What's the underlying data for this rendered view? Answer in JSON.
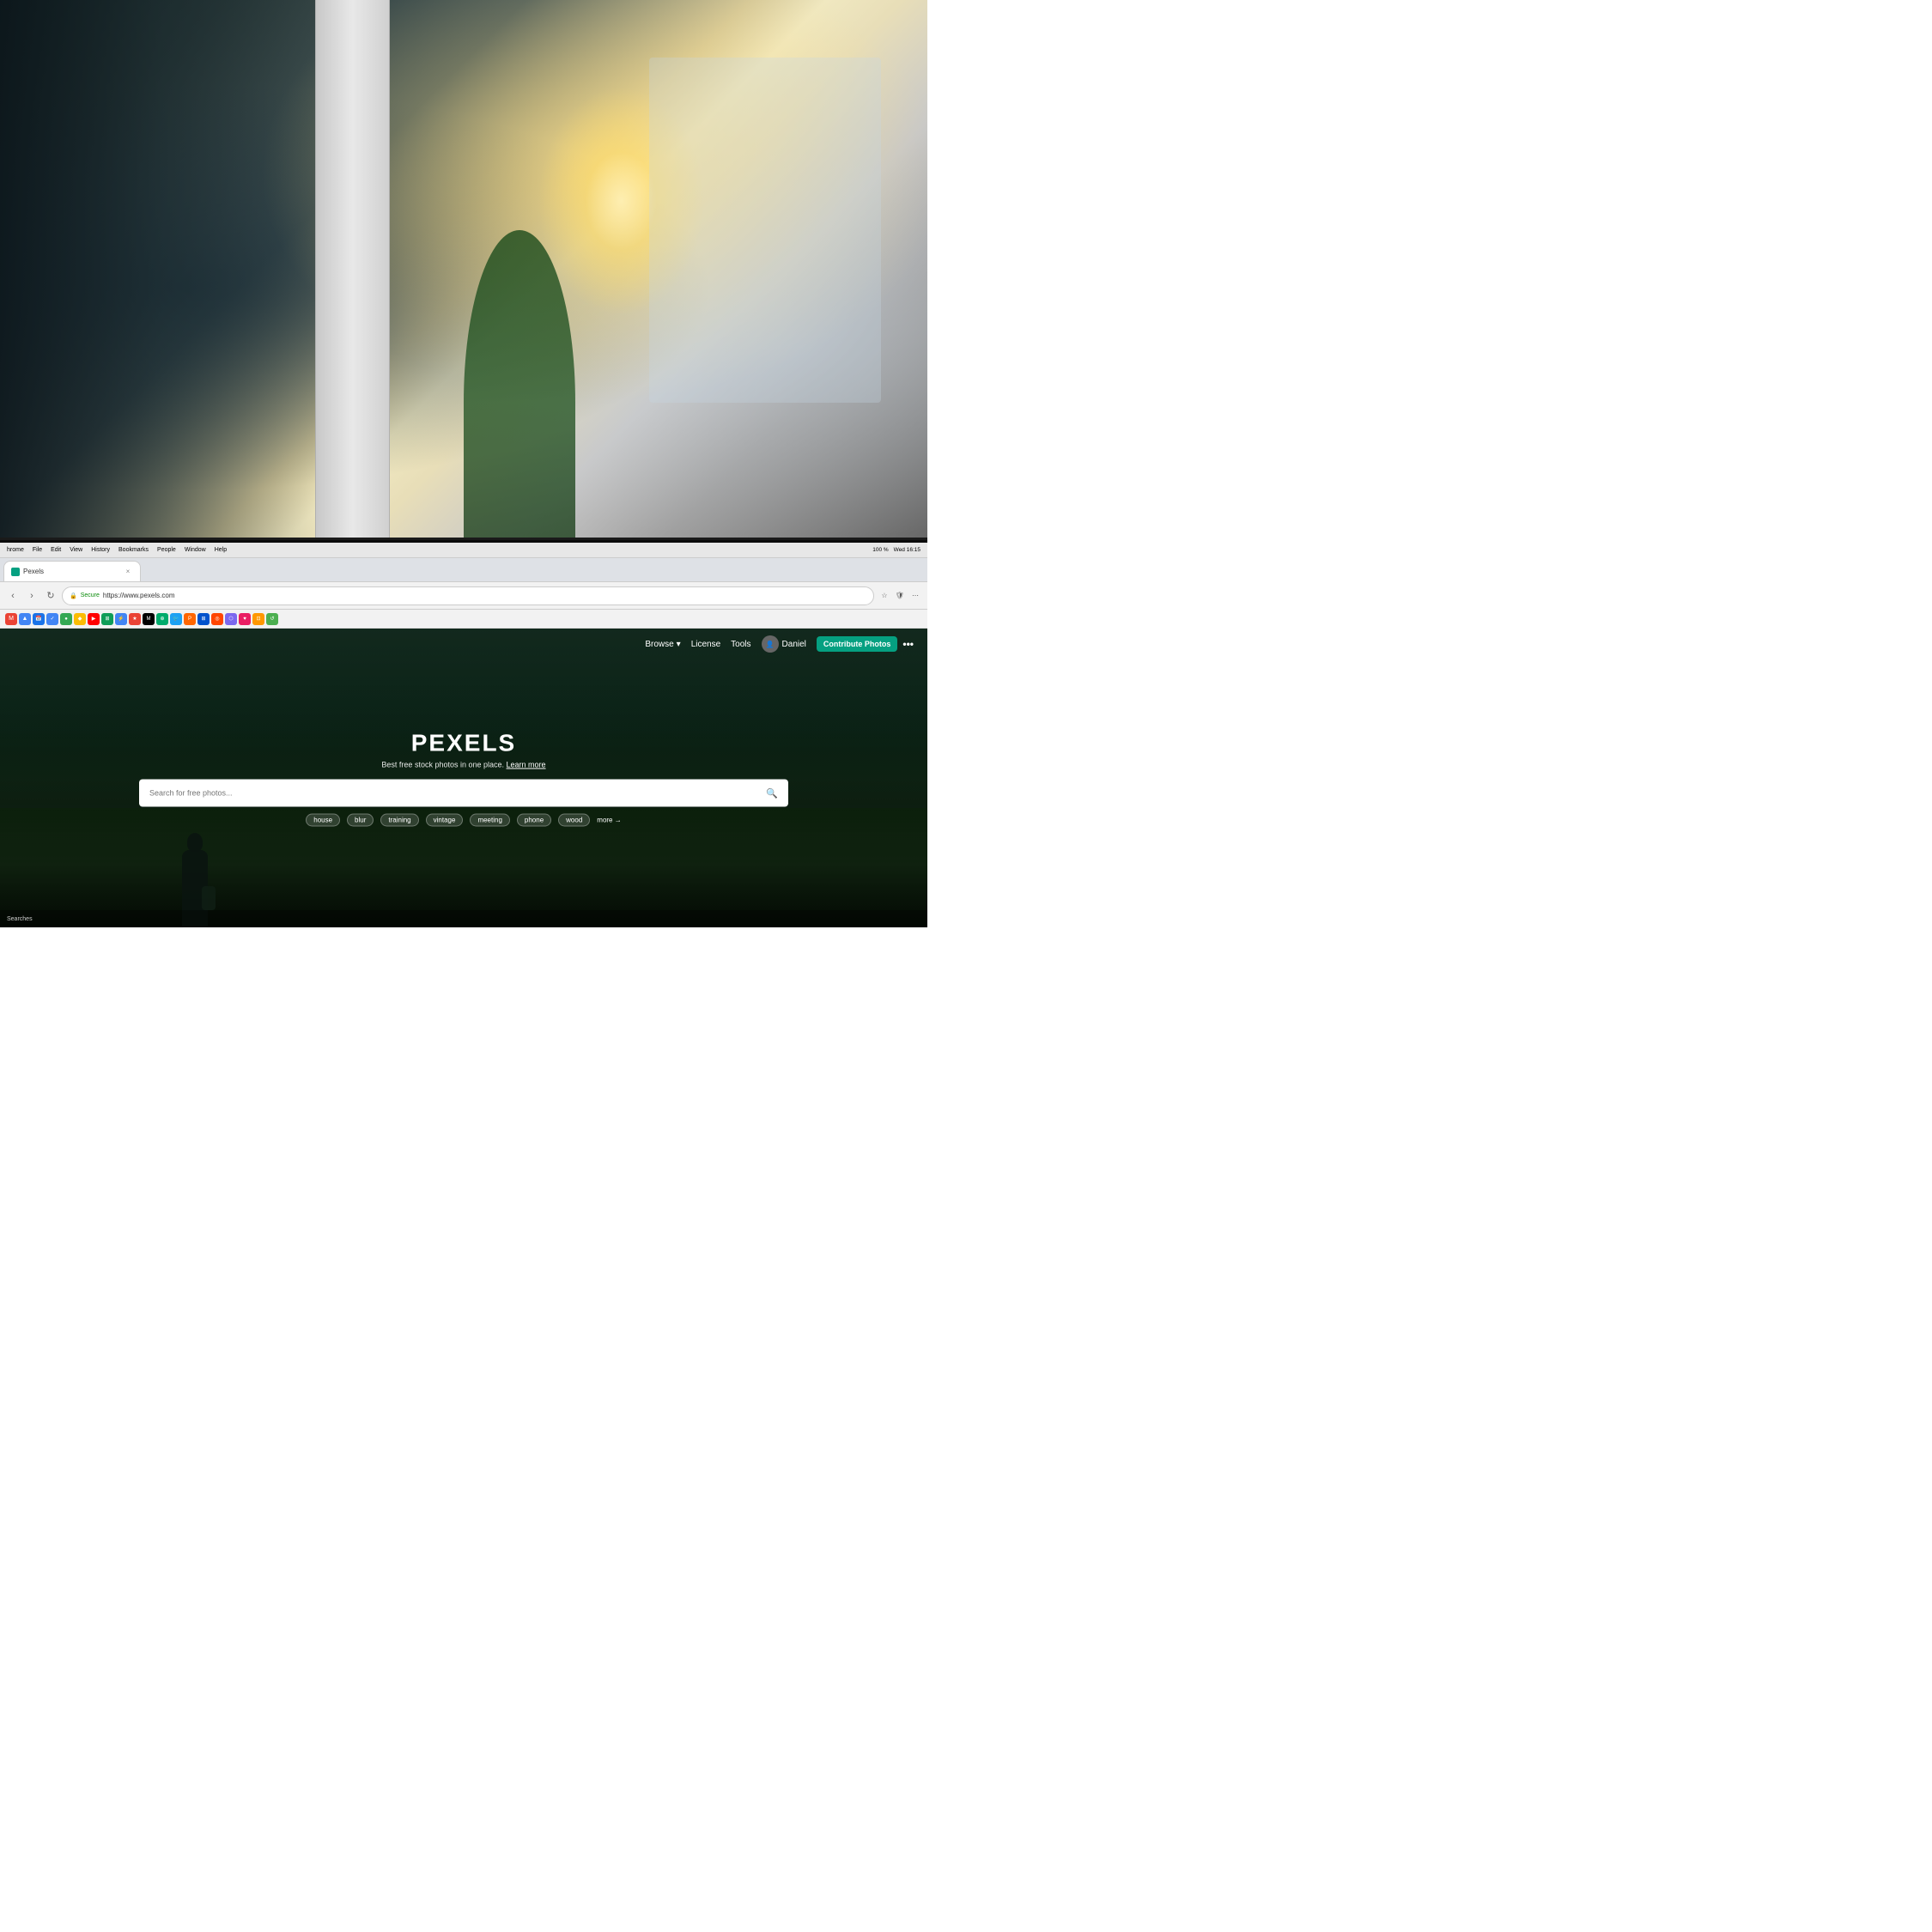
{
  "background": {
    "description": "Office workspace background photo, blurred, with pillar and plants"
  },
  "system": {
    "menubar": {
      "app_name": "hrome",
      "menus": [
        "File",
        "Edit",
        "View",
        "History",
        "Bookmarks",
        "People",
        "Window",
        "Help"
      ],
      "time": "Wed 16:15",
      "battery": "100 %"
    }
  },
  "browser": {
    "tab": {
      "title": "Pexels",
      "favicon_color": "#05a081"
    },
    "address": {
      "secure_label": "Secure",
      "url": "https://www.pexels.com",
      "url_display": "https://www.pexels.com"
    },
    "close_icon": "×"
  },
  "pexels": {
    "nav": {
      "browse_label": "Browse",
      "license_label": "License",
      "tools_label": "Tools",
      "username": "Daniel",
      "contribute_label": "Contribute Photos",
      "more_label": "•••"
    },
    "hero": {
      "logo": "PEXELS",
      "subtitle": "Best free stock photos in one place.",
      "learn_more": "Learn more",
      "search_placeholder": "Search for free photos...",
      "suggestions": [
        "house",
        "blur",
        "training",
        "vintage",
        "meeting",
        "phone",
        "wood"
      ],
      "more_link": "more →"
    }
  },
  "status": {
    "text": "Searches"
  }
}
